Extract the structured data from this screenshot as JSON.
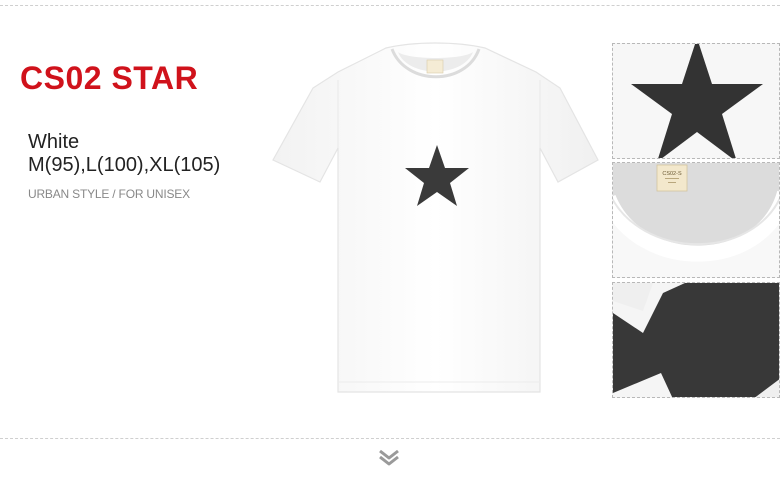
{
  "product": {
    "title": "CS02 STAR",
    "color": "White",
    "sizes": "M(95),L(100),XL(105)",
    "tagline": "URBAN STYLE / FOR UNISEX"
  },
  "colors": {
    "accent": "#d0121b",
    "star": "#3a3a3a",
    "shirt": "#ffffff"
  },
  "icons": {
    "scroll": "chevron-down-icon"
  },
  "label_text": "CS02-S"
}
